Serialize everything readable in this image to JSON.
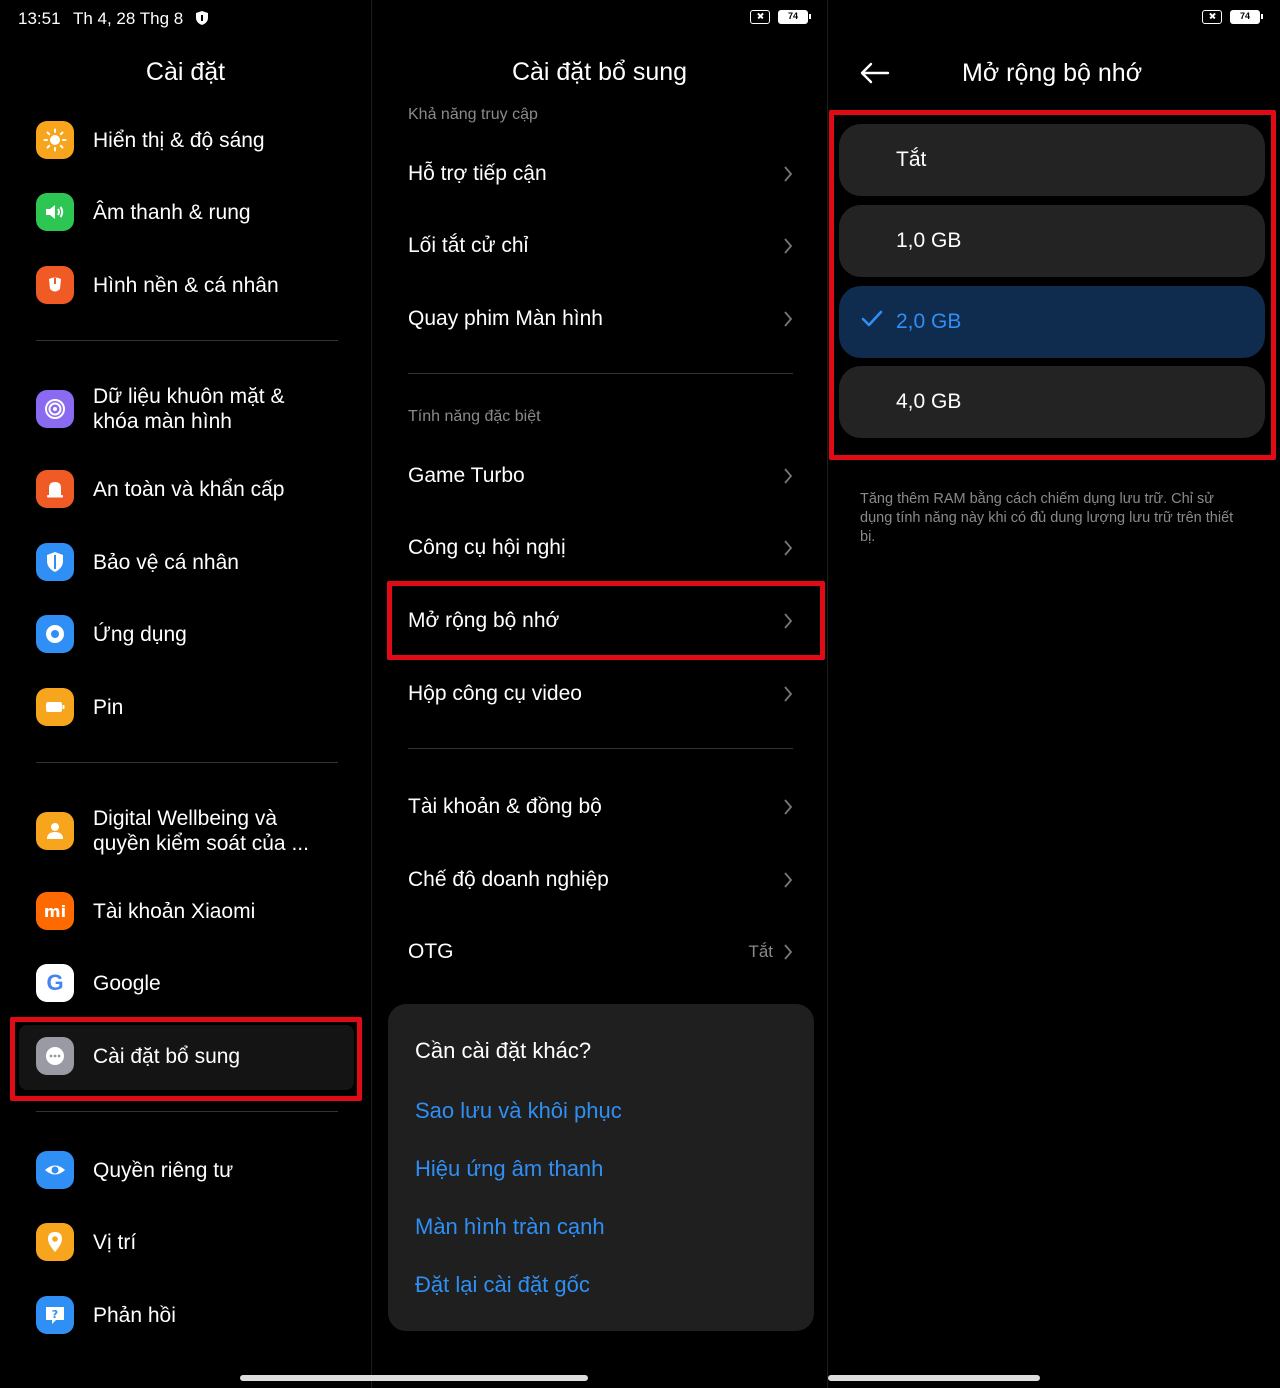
{
  "status": {
    "time": "13:51",
    "date": "Th 4, 28 Thg 8",
    "battery": "74"
  },
  "settings": {
    "title": "Cài đặt",
    "items": [
      {
        "label": "Hiển thị & độ sáng",
        "icon": "sun-icon",
        "color": "#f7a51c"
      },
      {
        "label": "Âm thanh & rung",
        "icon": "speaker-icon",
        "color": "#2dc653"
      },
      {
        "label": "Hình nền & cá nhân",
        "icon": "theme-icon",
        "color": "#f05a24"
      },
      {
        "label": "Dữ liệu khuôn mặt & khóa màn hình",
        "icon": "fingerprint-icon",
        "color": "#8a6af0"
      },
      {
        "label": "An toàn và khẩn cấp",
        "icon": "alarm-icon",
        "color": "#f05a24"
      },
      {
        "label": "Bảo vệ cá nhân",
        "icon": "shield-icon",
        "color": "#2f8ff4"
      },
      {
        "label": "Ứng dụng",
        "icon": "gear-icon",
        "color": "#2f8ff4"
      },
      {
        "label": "Pin",
        "icon": "battery-icon",
        "color": "#f7a51c"
      },
      {
        "label": "Digital Wellbeing và quyền kiểm soát của ...",
        "icon": "person-icon",
        "color": "#f7a51c"
      },
      {
        "label": "Tài khoản Xiaomi",
        "icon": "mi-logo-icon",
        "color": "#ff6a00"
      },
      {
        "label": "Google",
        "icon": "google-icon",
        "color": "#ffffff"
      },
      {
        "label": "Cài đặt bổ sung",
        "icon": "more-icon",
        "color": "#9a9aa5"
      },
      {
        "label": "Quyền riêng tư",
        "icon": "eye-icon",
        "color": "#2f8ff4"
      },
      {
        "label": "Vị trí",
        "icon": "location-pin-icon",
        "color": "#f7a51c"
      },
      {
        "label": "Phản hồi",
        "icon": "feedback-icon",
        "color": "#2f8ff4"
      }
    ]
  },
  "additional": {
    "title": "Cài đặt bổ sung",
    "section_accessibility": "Khả năng truy cập",
    "section_special": "Tính năng đặc biệt",
    "rows": [
      {
        "label": "Hỗ trợ tiếp cận"
      },
      {
        "label": "Lối tắt cử chỉ"
      },
      {
        "label": "Quay phim Màn hình"
      },
      {
        "label": "Game Turbo"
      },
      {
        "label": "Công cụ hội nghị"
      },
      {
        "label": "Mở rộng bộ nhớ"
      },
      {
        "label": "Hộp công cụ video"
      },
      {
        "label": "Tài khoản & đồng bộ"
      },
      {
        "label": "Chế độ doanh nghiệp"
      },
      {
        "label": "OTG",
        "value": "Tắt"
      }
    ],
    "card": {
      "title": "Cần cài đặt khác?",
      "links": [
        "Sao lưu và khôi phục",
        "Hiệu ứng âm thanh",
        "Màn hình tràn cạnh",
        "Đặt lại cài đặt gốc"
      ]
    }
  },
  "memory": {
    "title": "Mở rộng bộ nhớ",
    "options": [
      "Tắt",
      "1,0 GB",
      "2,0 GB",
      "4,0 GB"
    ],
    "selected": "2,0 GB",
    "description": "Tăng thêm RAM bằng cách chiếm dụng lưu trữ. Chỉ sử dụng tính năng này khi có đủ dung lượng lưu trữ trên thiết bị."
  },
  "colors": {
    "accent": "#2f8ff4",
    "highlight": "#e00b14",
    "selected_bg": "#0f2c4e"
  }
}
